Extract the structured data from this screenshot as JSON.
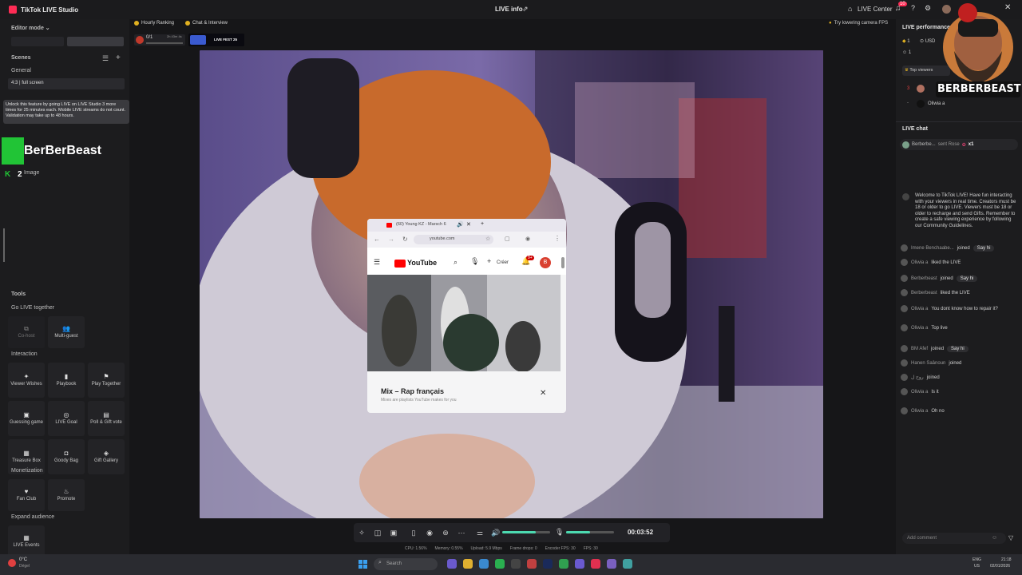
{
  "app": {
    "title": "TikTok LIVE Studio",
    "center_title": "LIVE info",
    "live_center": "LIVE Center",
    "notification_count": "10"
  },
  "left": {
    "editor_mode": "Editor mode",
    "scenes_label": "Scenes",
    "general_label": "General",
    "scene_name": "4:3 | full screen",
    "unlock_text": "Unlock this feature by going LIVE on LIVE Studio 3 more times for 25 minutes each. Mobile LIVE streams do not count. Validation may take up to 48 hours.",
    "image_label": "Image",
    "overlay_name": "BerBerBeast",
    "overlay_count": "2",
    "tools_label": "Tools",
    "go_live_together": "Go LIVE together",
    "cohost": "Co-host",
    "multiguest": "Multi-guest",
    "interaction": "Interaction",
    "viewer_wishes": "Viewer Wishes",
    "playbook": "Playbook",
    "play_together": "Play Together",
    "guessing_game": "Guessing game",
    "live_goal": "LIVE Goal",
    "poll_gift": "Poll & Gift vote",
    "treasure_box": "Treasure Box",
    "goody_bag": "Goody Bag",
    "gift_gallery": "Gift Gallery",
    "monetization": "Monetization",
    "fan_club": "Fan Club",
    "promote": "Promote",
    "expand_audience": "Expand audience",
    "live_events": "LIVE Events"
  },
  "topbar": {
    "hourly_ranking": "Hourly Ranking",
    "chat_interview": "Chat & Interview",
    "rank_value": "0/1",
    "rank_time": "2h 43m 4s",
    "fps_hint": "Try lowering camera FPS",
    "live_fest": "LIVE FEST 25"
  },
  "popup": {
    "tab_title": "(60) Young KZ - Marsch 6",
    "url": "youtube.com",
    "yt_label": "YouTube",
    "create_label": "Créer",
    "notif": "9+",
    "avatar_letter": "B",
    "mix_title": "Mix – Rap français",
    "mix_sub": "Mixes are playlists YouTube makes for you"
  },
  "controls": {
    "timer": "00:03:52",
    "volume_level": 0.7,
    "mic_level": 0.5
  },
  "stats": {
    "cpu": "CPU: 1.56%",
    "memory": "Memory: 0.55%",
    "upload": "Upload: 5.9 Mbps",
    "frame_drops": "Frame drops: 0",
    "encoder_fps": "Encoder FPS: 30",
    "fps": "FPS: 30"
  },
  "right": {
    "live_performance": "LIVE performance",
    "usd": "USD",
    "stat_a": "1",
    "stat_b": "1",
    "top_viewers": "Top viewers",
    "top_num": "3",
    "viewer2": "Oliwia a",
    "brand": "BERBERBEAST",
    "live_chat": "LIVE chat",
    "gift_user": "Berberbe...",
    "gift_text": "sent Rose",
    "gift_count": "x1",
    "welcome": "Welcome to TikTok LIVE! Have fun interacting with your viewers in real time. Creators must be 18 or older to go LIVE. Viewers must be 18 or older to recharge and send Gifts. Remember to create a safe viewing experience by following our Community Guidelines.",
    "say_hi": "Say hi",
    "add_comment": "Add comment",
    "messages": [
      {
        "user": "Imene Benchaabe...",
        "text": "joined",
        "sayhi": true
      },
      {
        "user": "Oliwia a",
        "text": "liked the LIVE",
        "sayhi": false
      },
      {
        "user": "Berberbeast",
        "text": "joined",
        "sayhi": true
      },
      {
        "user": "Berberbeast",
        "text": "liked the LIVE",
        "sayhi": false
      },
      {
        "user": "Oliwia a",
        "text": "You dont know how to repair it?",
        "sayhi": false
      },
      {
        "user": "Oliwia a",
        "text": "Top live",
        "sayhi": false
      },
      {
        "user": "BM Afef",
        "text": "joined",
        "sayhi": true
      },
      {
        "user": "Hanen Saânoun",
        "text": "joined",
        "sayhi": false
      },
      {
        "user": "روح ل",
        "text": "joined",
        "sayhi": false
      },
      {
        "user": "Oliwia a",
        "text": "Is it",
        "sayhi": false
      },
      {
        "user": "Oliwia a",
        "text": "Oh no",
        "sayhi": false
      }
    ]
  },
  "taskbar": {
    "weather": "0°C",
    "weather_sub": "Dégel",
    "search": "Search",
    "lang": "ENG",
    "lang_sub": "US",
    "time": "21:18",
    "date": "02/01/2026"
  }
}
